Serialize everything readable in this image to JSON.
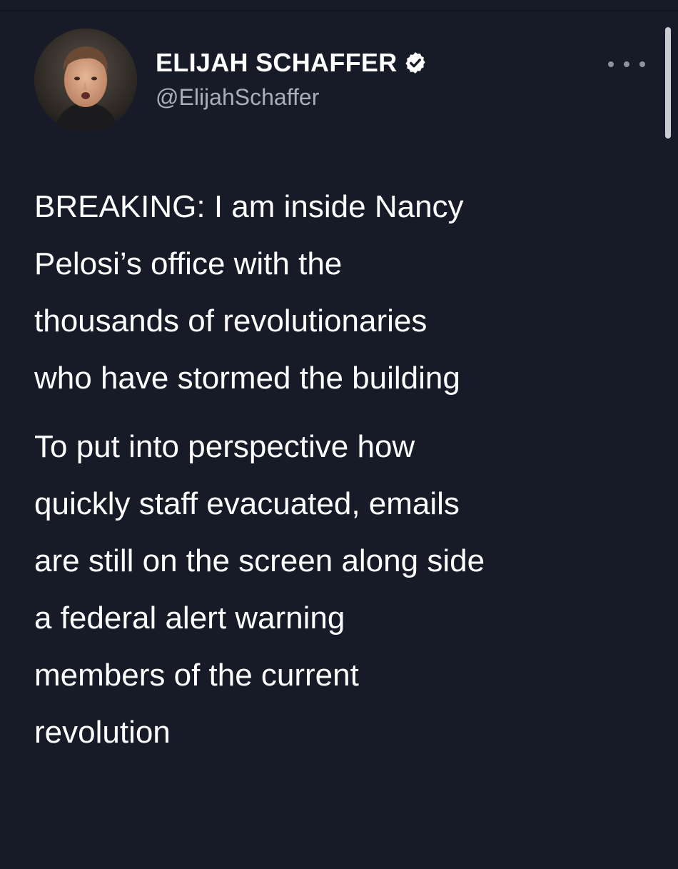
{
  "tweet": {
    "author": {
      "display_name": "ELIJAH SCHAFFER",
      "handle": "@ElijahSchaffer",
      "verified": true,
      "avatar": "avatar-photo"
    },
    "more_icon": "more-options-icon",
    "body": {
      "paragraph_1": "BREAKING: I am inside Nancy\nPelosi’s office with the\nthousands of revolutionaries\nwho have stormed the building",
      "paragraph_2": "To put into perspective how\nquickly staff evacuated, emails\nare still on the screen along side\na federal alert warning\nmembers of the current\nrevolution"
    }
  },
  "colors": {
    "background": "#161b27",
    "text": "#ffffff",
    "handle": "#a6afbb",
    "more_dots": "#8a93a0",
    "scrollbar": "#c9ccd2"
  }
}
